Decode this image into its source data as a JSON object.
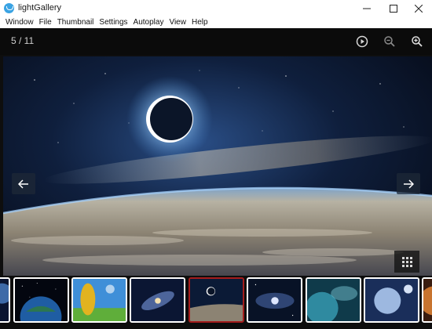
{
  "window": {
    "title": "lightGallery",
    "controls": [
      "minimize",
      "maximize",
      "close"
    ]
  },
  "menu": {
    "items": [
      {
        "label": "Window"
      },
      {
        "label": "File"
      },
      {
        "label": "Thumbnail"
      },
      {
        "label": "Settings"
      },
      {
        "label": "Autoplay"
      },
      {
        "label": "View"
      },
      {
        "label": "Help"
      }
    ]
  },
  "gallery": {
    "counter": "5 / 11",
    "current_index": 5,
    "total": 11,
    "toolbar": {
      "play_icon": "play-circle-icon",
      "zoom_out_icon": "zoom-out-icon",
      "zoom_in_icon": "zoom-in-icon"
    },
    "nav": {
      "prev_icon": "arrow-left-icon",
      "next_icon": "arrow-right-icon"
    },
    "grid_icon": "grid-icon",
    "main_image": "eclipse-over-earth",
    "thumbnails": [
      {
        "subject": "planet-partial",
        "active": false
      },
      {
        "subject": "planet-earth-stars",
        "active": false
      },
      {
        "subject": "golden-figure-sky",
        "active": false
      },
      {
        "subject": "spiral-galaxy",
        "active": false
      },
      {
        "subject": "eclipse-over-earth",
        "active": true
      },
      {
        "subject": "galaxy-stars",
        "active": false
      },
      {
        "subject": "blue-planet-nebula",
        "active": false
      },
      {
        "subject": "moon-planet",
        "active": false
      },
      {
        "subject": "orange-planet-partial",
        "active": false
      }
    ]
  },
  "colors": {
    "active_thumb_border": "#a51c1c",
    "gallery_bg": "#0e0e0e",
    "app_icon": "#3aa3e3"
  }
}
